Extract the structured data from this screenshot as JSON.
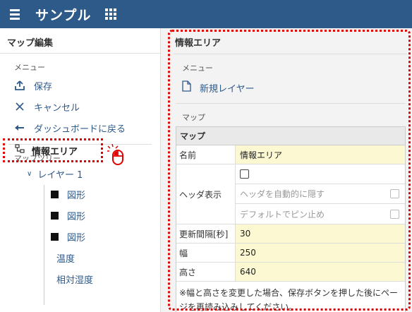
{
  "app": {
    "title": "サンプル"
  },
  "left_panel": {
    "header": "マップ編集",
    "menu_label": "メニュー",
    "menu_items": [
      {
        "icon": "upload-icon",
        "label": "保存"
      },
      {
        "icon": "close-icon",
        "label": "キャンセル"
      },
      {
        "icon": "back-arrow-icon",
        "label": "ダッシュボードに戻る"
      }
    ],
    "tree_label": "マップツリー",
    "tree_root": "情報エリア",
    "layer": "レイヤー 1",
    "nodes": [
      {
        "label": "図形",
        "icon": "black-square-icon"
      },
      {
        "label": "図形",
        "icon": "black-square-icon"
      },
      {
        "label": "図形",
        "icon": "black-square-icon"
      },
      {
        "label": "温度"
      },
      {
        "label": "相対湿度"
      }
    ]
  },
  "right_panel": {
    "header": "情報エリア",
    "menu_label": "メニュー",
    "new_layer": "新規レイヤー",
    "map_label": "マップ",
    "form": {
      "title": "マップ",
      "name_label": "名前",
      "name_value": "情報エリア",
      "header_label": "ヘッダ表示",
      "auto_hide_label": "ヘッダを自動的に隠す",
      "pin_label": "デフォルトでピン止め",
      "interval_label": "更新間隔[秒]",
      "interval_value": "30",
      "width_label": "幅",
      "width_value": "250",
      "height_label": "高さ",
      "height_value": "640",
      "note": "※幅と高さを変更した場合、保存ボタンを押した後にページを再読み込みしてください。"
    }
  },
  "colors": {
    "topbar": "#2e5a8a",
    "link": "#2e5a8a",
    "highlight": "#e00000",
    "input_bg": "#fbf8d2"
  }
}
